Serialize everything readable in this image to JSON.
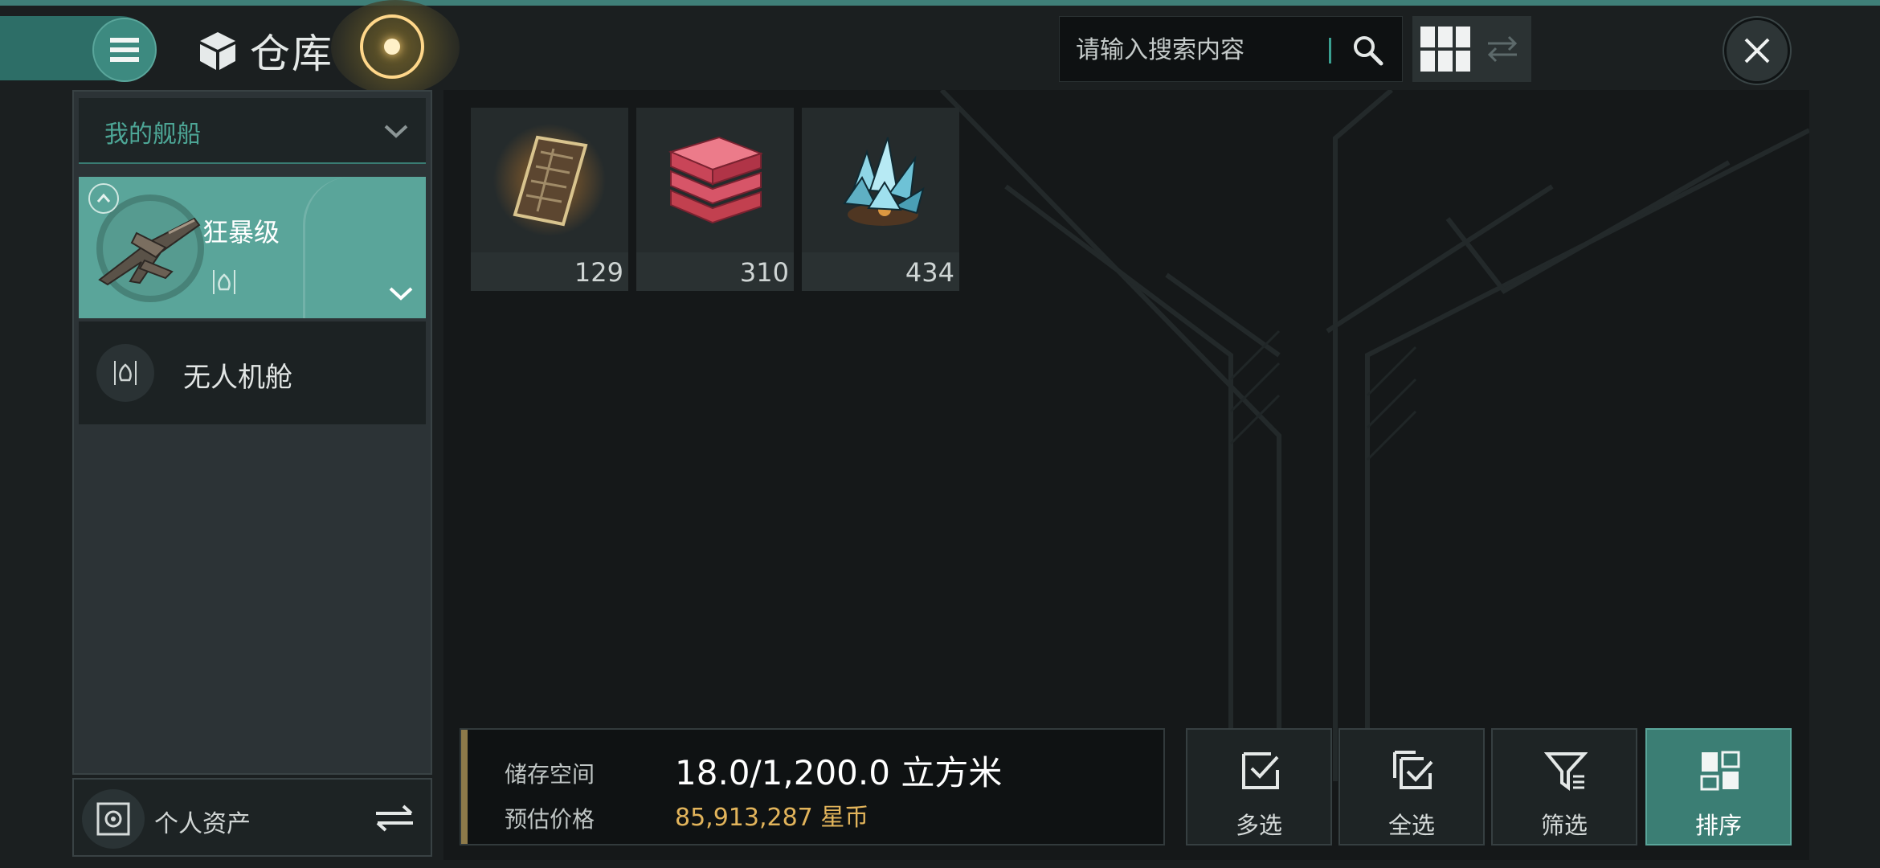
{
  "header": {
    "title": "仓库",
    "search_placeholder": "请输入搜索内容"
  },
  "sidebar": {
    "dropdown_label": "我的舰船",
    "ship_name": "狂暴级",
    "drone_bay_label": "无人机舱",
    "assets_label": "个人资产"
  },
  "items": [
    {
      "icon": "blueprint-scroll-icon",
      "count": "129"
    },
    {
      "icon": "red-ingot-stack-icon",
      "count": "310"
    },
    {
      "icon": "blue-crystal-ore-icon",
      "count": "434"
    }
  ],
  "footer": {
    "storage_label": "储存空间",
    "storage_value": "18.0/1,200.0 立方米",
    "price_label": "预估价格",
    "price_value": "85,913,287 星币"
  },
  "actions": {
    "multi_select": "多选",
    "select_all": "全选",
    "filter": "筛选",
    "sort": "排序"
  },
  "colors": {
    "accent_teal": "#3b7e74",
    "price_gold": "#e2b45b",
    "background": "#151819"
  }
}
